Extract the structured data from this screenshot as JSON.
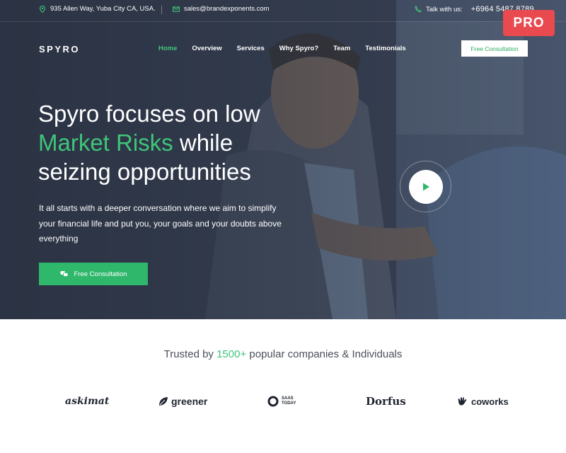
{
  "topbar": {
    "address": "935 Allen Way, Yuba City CA, USA.",
    "email": "sales@brandexponents.com",
    "phone_label": "Talk with us:",
    "phone_number": "+6964 5487 8789"
  },
  "badge": {
    "label": "PRO"
  },
  "header": {
    "logo": "SPYRO",
    "nav": [
      {
        "label": "Home",
        "active": true
      },
      {
        "label": "Overview"
      },
      {
        "label": "Services"
      },
      {
        "label": "Why Spyro?"
      },
      {
        "label": "Team"
      },
      {
        "label": "Testimonials"
      }
    ],
    "cta_label": "Free Consultation"
  },
  "hero": {
    "headline_line1": "Spyro focuses on low",
    "headline_accent": "Market Risks",
    "headline_line2_rest": " while",
    "headline_line3": "seizing opportunities",
    "subtext": "It all starts with a deeper conversation where we aim to simplify your financial life and put you, your goals and your doubts above everything",
    "cta_label": "Free Consultation"
  },
  "trusted": {
    "prefix": "Trusted by ",
    "count": "1500+",
    "suffix": " popular companies & Individuals"
  },
  "brands": {
    "askimat": "askimat",
    "greener": "greener",
    "saas_line1": "SAAS",
    "saas_line2": "TODAY",
    "dorfus": "Dorfus",
    "coworks": "coworks"
  },
  "colors": {
    "accent_green": "#3fc57a",
    "button_green": "#2fb86c",
    "pro_red": "#e84a4f"
  }
}
